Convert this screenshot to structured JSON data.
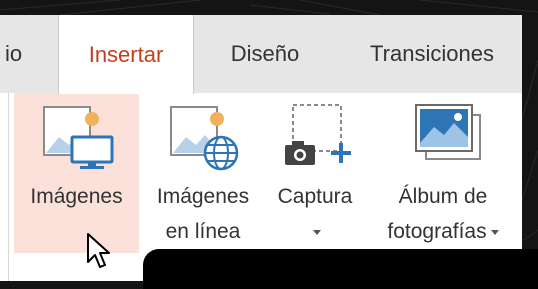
{
  "tabs": [
    {
      "label": "io",
      "active": false
    },
    {
      "label": "Insertar",
      "active": true
    },
    {
      "label": "Diseño",
      "active": false
    },
    {
      "label": "Transiciones",
      "active": false
    }
  ],
  "ribbon": {
    "buttons": [
      {
        "line1": "Imágenes",
        "line2": "",
        "dropdown": false,
        "hover": true,
        "icon": "picture-monitor-icon"
      },
      {
        "line1": "Imágenes",
        "line2": "en línea",
        "dropdown": false,
        "hover": false,
        "icon": "online-picture-icon"
      },
      {
        "line1": "Captura",
        "line2": "",
        "dropdown": true,
        "hover": false,
        "icon": "screenshot-camera-icon"
      },
      {
        "line1": "Álbum de",
        "line2": "fotografías",
        "dropdown": true,
        "hover": false,
        "icon": "photo-album-icon"
      }
    ]
  },
  "colors": {
    "accent_tab_text": "#c43e1c",
    "hover_bg": "#fbe1d9",
    "icon_blue": "#2e75b6",
    "sun_orange": "#f2b15d"
  }
}
